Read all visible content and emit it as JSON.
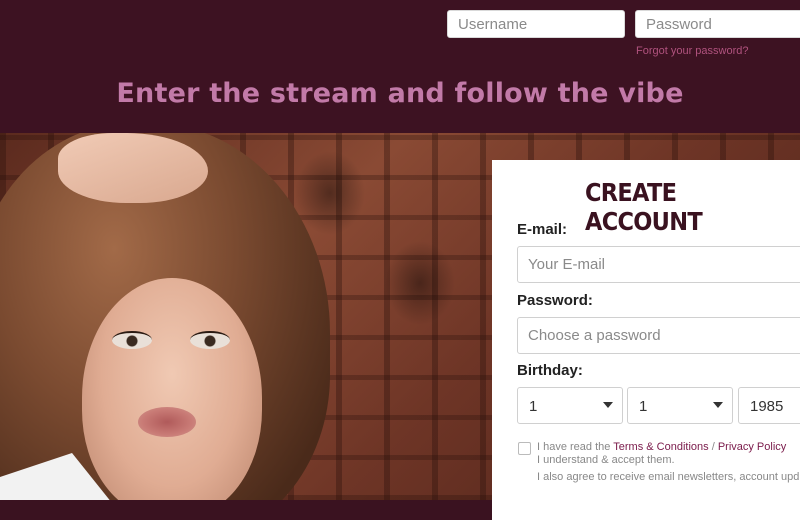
{
  "login": {
    "username_placeholder": "Username",
    "password_placeholder": "Password",
    "forgot_label": "Forgot your password?"
  },
  "tagline": "Enter the stream and follow the vibe",
  "signup": {
    "title": "CREATE ACCOUNT",
    "email_label": "E-mail:",
    "email_placeholder": "Your E-mail",
    "password_label": "Password:",
    "password_placeholder": "Choose a password",
    "birthday_label": "Birthday:",
    "birthday_day": "1",
    "birthday_month": "1",
    "birthday_year": "1985",
    "terms_prefix": "I have read the",
    "terms_link": "Terms & Conditions",
    "terms_sep": "/",
    "privacy_link": "Privacy Policy",
    "terms_line2": "I understand & accept them.",
    "newsletter_text": "I also agree to receive email newsletters, account upd"
  },
  "colors": {
    "header_bg": "#3d1222",
    "tagline": "#c27aa8",
    "link": "#b0527e",
    "title": "#3a1220"
  },
  "icons": [
    "caret-down-icon"
  ]
}
